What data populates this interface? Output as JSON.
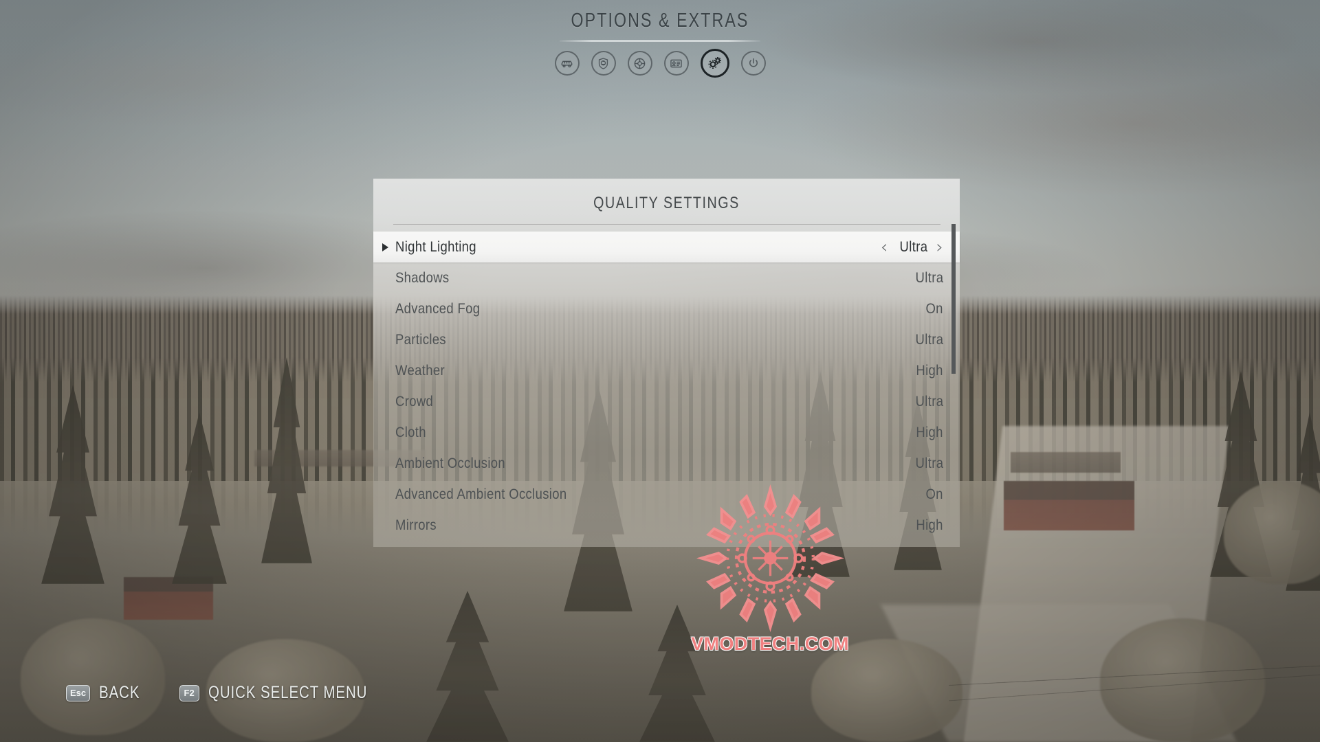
{
  "header": {
    "title": "OPTIONS & EXTRAS",
    "icons": [
      {
        "name": "car-icon",
        "label": "Car",
        "selected": false
      },
      {
        "name": "helmet-shield-icon",
        "label": "Driver",
        "selected": false
      },
      {
        "name": "wheel-icon",
        "label": "Wheel",
        "selected": false
      },
      {
        "name": "profile-card-icon",
        "label": "Profile",
        "selected": false
      },
      {
        "name": "gears-icon",
        "label": "Settings",
        "selected": true
      },
      {
        "name": "power-icon",
        "label": "Quit",
        "selected": false
      }
    ]
  },
  "panel": {
    "title": "QUALITY SETTINGS",
    "selected_index": 0,
    "prev_chevron": "‹",
    "next_chevron": "›",
    "rows": [
      {
        "label": "Night Lighting",
        "value": "Ultra"
      },
      {
        "label": "Shadows",
        "value": "Ultra"
      },
      {
        "label": "Advanced Fog",
        "value": "On"
      },
      {
        "label": "Particles",
        "value": "Ultra"
      },
      {
        "label": "Weather",
        "value": "High"
      },
      {
        "label": "Crowd",
        "value": "Ultra"
      },
      {
        "label": "Cloth",
        "value": "High"
      },
      {
        "label": "Ambient Occlusion",
        "value": "Ultra"
      },
      {
        "label": "Advanced Ambient Occlusion",
        "value": "On"
      },
      {
        "label": "Mirrors",
        "value": "High"
      }
    ]
  },
  "keyhints": [
    {
      "key": "Esc",
      "label": "BACK"
    },
    {
      "key": "F2",
      "label": "QUICK SELECT MENU"
    }
  ],
  "watermark": {
    "text": "VMODTECH.COM",
    "color": "#f08080"
  },
  "colors": {
    "header_text": "#3b4347",
    "panel_text": "#4e5254",
    "selected_row_bg": "#f6f6f5",
    "scrollbar": "#55585a",
    "keycap": "#888e90"
  }
}
